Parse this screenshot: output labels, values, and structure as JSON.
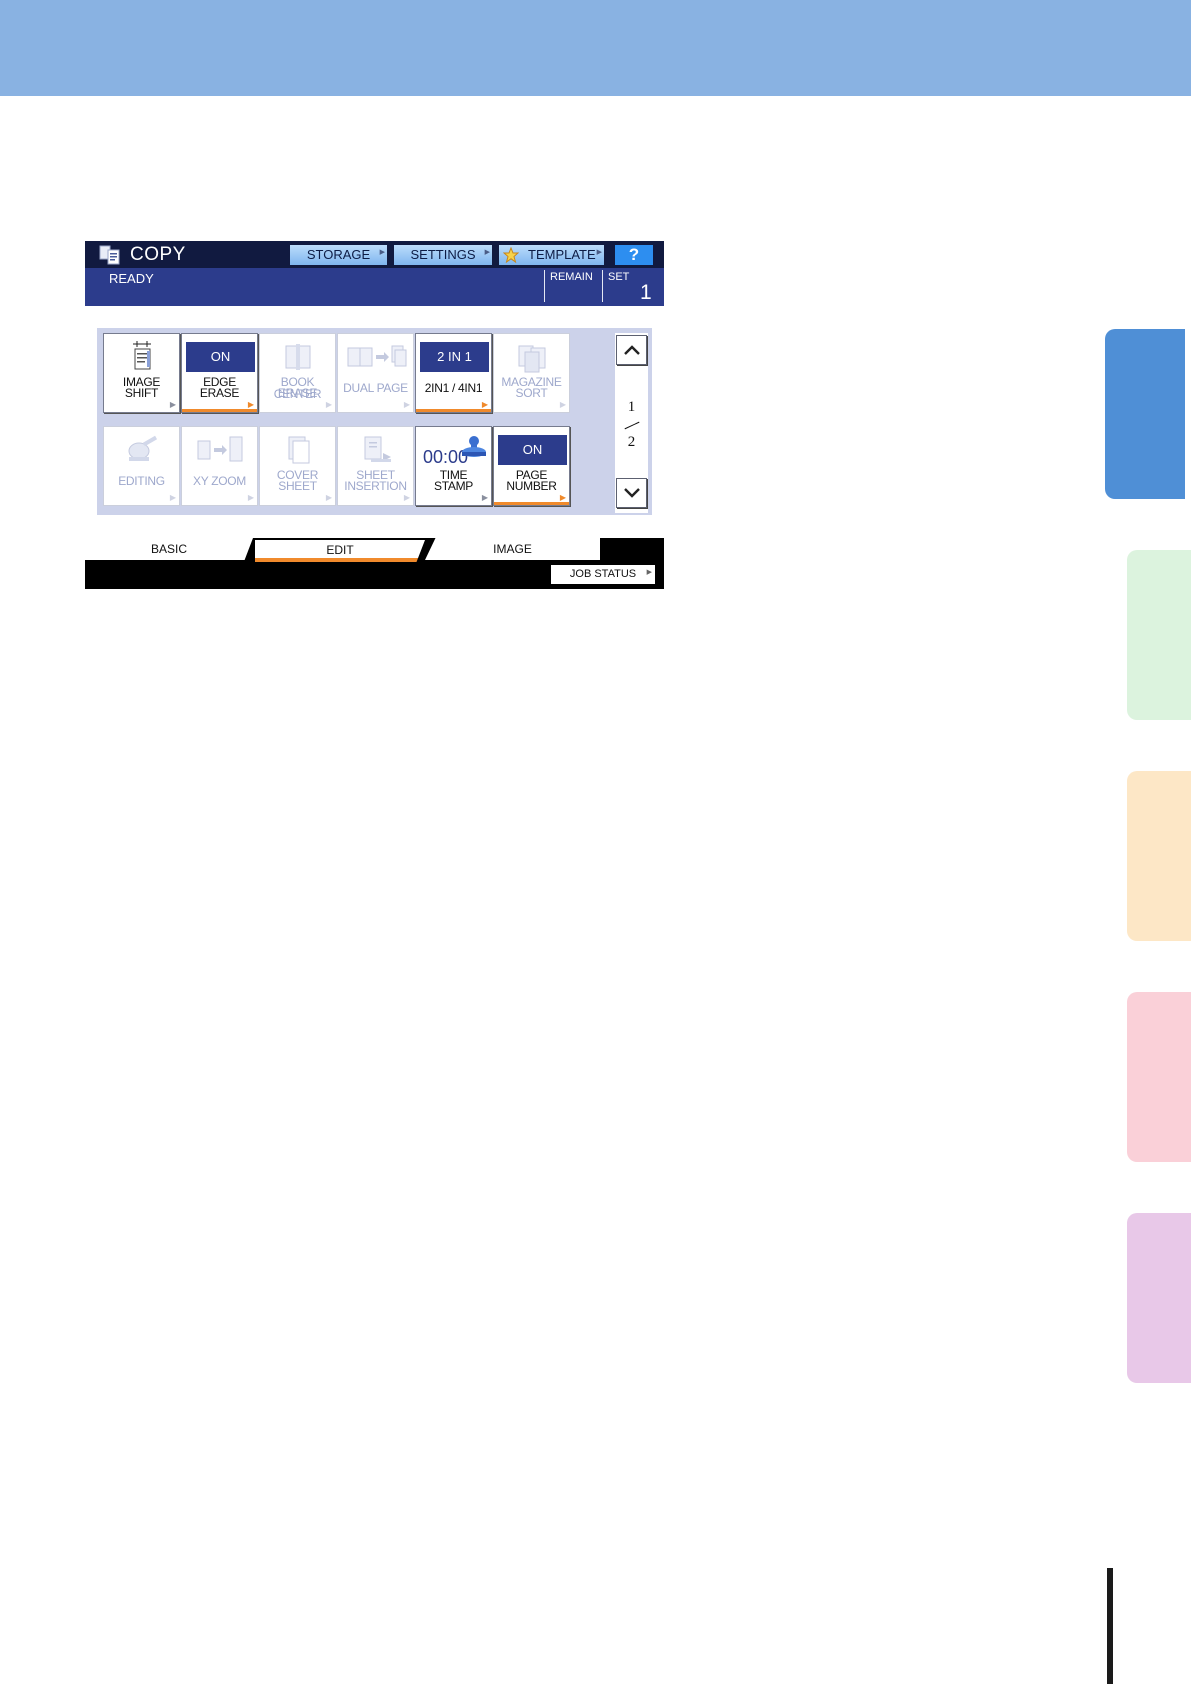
{
  "header": {
    "title": "COPY",
    "buttons": {
      "storage": "STORAGE",
      "settings": "SETTINGS",
      "template": "TEMPLATE",
      "help": "?"
    }
  },
  "status": {
    "state": "READY",
    "remain_label": "REMAIN",
    "set_label": "SET",
    "set_value": "1"
  },
  "functions": {
    "image_shift": {
      "line1": "IMAGE",
      "line2": "SHIFT"
    },
    "edge_erase": {
      "badge": "ON",
      "line1": "EDGE",
      "line2": "ERASE"
    },
    "book_center_erase": {
      "line1": "BOOK CENTER",
      "line2": "ERASE"
    },
    "dual_page": {
      "label": "DUAL PAGE"
    },
    "two_in_one": {
      "badge": "2 IN 1",
      "label": "2IN1 / 4IN1"
    },
    "magazine_sort": {
      "line1": "MAGAZINE",
      "line2": "SORT"
    },
    "editing": {
      "label": "EDITING"
    },
    "xy_zoom": {
      "label": "XY ZOOM"
    },
    "cover_sheet": {
      "line1": "COVER",
      "line2": "SHEET"
    },
    "sheet_insertion": {
      "line1": "SHEET",
      "line2": "INSERTION"
    },
    "time_stamp": {
      "display": "00:00",
      "line1": "TIME",
      "line2": "STAMP"
    },
    "page_number": {
      "badge": "ON",
      "line1": "PAGE",
      "line2": "NUMBER"
    }
  },
  "pager": {
    "current": "1",
    "total": "2"
  },
  "tabs": {
    "basic": "BASIC",
    "edit": "EDIT",
    "image": "IMAGE"
  },
  "job_status": "JOB STATUS",
  "colors": {
    "banner": "#89b2e2",
    "screen_header": "#111a40",
    "status_bar": "#2c3c8c",
    "grid_panel": "#ccd2ea",
    "accent_orange": "#f08a2c",
    "button_blue": "#7fb6ef",
    "side_tabs": [
      "#4f8fd6",
      "#dcf3de",
      "#fde7c6",
      "#fad0d8",
      "#e8c8e8"
    ]
  }
}
